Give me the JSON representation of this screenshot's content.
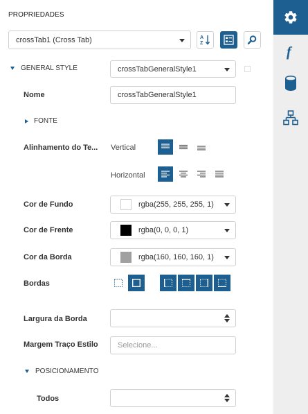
{
  "panel": {
    "title": "PROPRIEDADES",
    "component_select": {
      "value": "crossTab1 (Cross Tab)"
    },
    "toolbar": {
      "sort_icon": "sort-az-icon",
      "categorized_icon": "categorized-view-icon",
      "search_icon": "search-icon"
    },
    "general_style": {
      "section_label": "GENERAL STYLE",
      "style_select": "crossTabGeneralStyle1"
    },
    "nome": {
      "label": "Nome",
      "value": "crossTabGeneralStyle1"
    },
    "fonte": {
      "label": "FONTE"
    },
    "alinhamento": {
      "label": "Alinhamento do Te...",
      "vertical_label": "Vertical",
      "horizontal_label": "Horizontal",
      "vertical_options": [
        "top",
        "middle",
        "bottom"
      ],
      "vertical_selected": "top",
      "horizontal_options": [
        "left",
        "center",
        "right",
        "justify"
      ],
      "horizontal_selected": "left"
    },
    "cor_fundo": {
      "label": "Cor de Fundo",
      "value": "rgba(255, 255, 255, 1)",
      "swatch": "#ffffff"
    },
    "cor_frente": {
      "label": "Cor de Frente",
      "value": "rgba(0, 0, 0, 1)",
      "swatch": "#000000"
    },
    "cor_borda": {
      "label": "Cor da Borda",
      "value": "rgba(160, 160, 160, 1)",
      "swatch": "#a0a0a0"
    },
    "bordas": {
      "label": "Bordas"
    },
    "largura_borda": {
      "label": "Largura da Borda",
      "value": ""
    },
    "margem_traco": {
      "label": "Margem Traço Estilo",
      "placeholder": "Selecione..."
    },
    "posicionamento": {
      "label": "POSICIONAMENTO"
    },
    "todos": {
      "label": "Todos",
      "value": ""
    }
  },
  "rail": {
    "items": [
      {
        "icon": "gear-icon",
        "active": true
      },
      {
        "icon": "function-icon",
        "active": false
      },
      {
        "icon": "database-icon",
        "active": false
      },
      {
        "icon": "hierarchy-icon",
        "active": false
      }
    ]
  },
  "colors": {
    "accent": "#1e5f91",
    "rail_bg": "#eeeeee",
    "border": "#cfcfcf"
  }
}
